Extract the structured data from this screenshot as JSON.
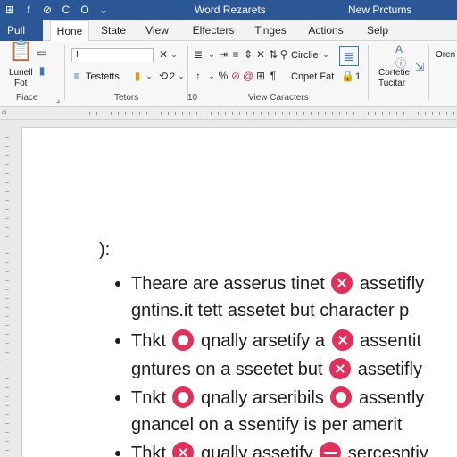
{
  "window": {
    "title_left": "Word Rezarets",
    "title_right": "New Prctums",
    "quick_access": [
      "⊞",
      "f",
      "⊘",
      "C",
      "O",
      "⌄"
    ]
  },
  "tabs": [
    {
      "label": "Pull",
      "kind": "file"
    },
    {
      "label": "Hone",
      "kind": "active"
    },
    {
      "label": "State",
      "kind": "normal"
    },
    {
      "label": "View",
      "kind": "normal"
    },
    {
      "label": "Elfecters",
      "kind": "normal"
    },
    {
      "label": "Tinges",
      "kind": "normal"
    },
    {
      "label": "Actions",
      "kind": "normal"
    },
    {
      "label": "Selp",
      "kind": "normal"
    }
  ],
  "ribbon": {
    "clipboard": {
      "big_label_1": "Lunell",
      "big_label_2": "Fot",
      "group_label": "Fiace"
    },
    "font": {
      "font_value": "I",
      "style_value": "Testetts",
      "size_value": "2",
      "group_label": "Tetors"
    },
    "paragraph": {
      "group_label_num": "10"
    },
    "styles": {
      "style_combo": "Circlie",
      "style_combo2": "Cnpet Fat",
      "count": "1",
      "group_label": "View Caracters"
    },
    "editing": {
      "label_1": "Cortetie",
      "label_2": "Tucitar",
      "side": "Oren"
    }
  },
  "document": {
    "heading": "):",
    "lines": [
      {
        "bullet": true,
        "pre": "Theare are asserus tinet",
        "badge1": "x",
        "post": "assetifly",
        "badge2": null,
        "tail": ""
      },
      {
        "bullet": false,
        "pre": "gntins.it tett assetet but character p",
        "badge1": null,
        "post": "",
        "badge2": null,
        "tail": ""
      },
      {
        "bullet": true,
        "pre": "Thkt",
        "badge1": "o",
        "post": "qnally arsetify a",
        "badge2": "x",
        "tail": "assentit"
      },
      {
        "bullet": false,
        "pre": "gntures on a sseetet but",
        "badge1": "x",
        "post": "assetifly",
        "badge2": null,
        "tail": ""
      },
      {
        "bullet": true,
        "pre": "Tnkt",
        "badge1": "o",
        "post": "qnally arseribils",
        "badge2": "o",
        "tail": "assently"
      },
      {
        "bullet": false,
        "pre": "gnancel on a ssentify is per amerit",
        "badge1": null,
        "post": "",
        "badge2": null,
        "tail": ""
      },
      {
        "bullet": true,
        "pre": "Thkt",
        "badge1": "x",
        "post": "qually assetify",
        "badge2": "minus",
        "tail": "sercesntiy"
      }
    ]
  },
  "colors": {
    "accent": "#2b5797",
    "badge": "#e2305b"
  }
}
